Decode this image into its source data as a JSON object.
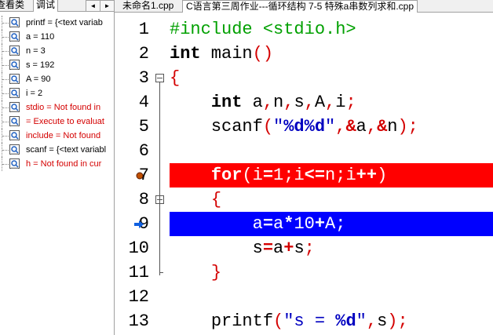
{
  "left_panel": {
    "tabs": [
      "查看类",
      "调试"
    ],
    "arrows": [
      "◄",
      "►"
    ],
    "watches": [
      {
        "text": "printf = {<text variab",
        "error": false
      },
      {
        "text": "a = 110",
        "error": false
      },
      {
        "text": "n = 3",
        "error": false
      },
      {
        "text": "s = 192",
        "error": false
      },
      {
        "text": "A = 90",
        "error": false
      },
      {
        "text": "i = 2",
        "error": false
      },
      {
        "text": "stdio = Not found in",
        "error": true
      },
      {
        "text": " = Execute to evaluat",
        "error": true
      },
      {
        "text": "include = Not found",
        "error": true
      },
      {
        "text": "scanf = {<text variabl",
        "error": false
      },
      {
        "text": "h = Not found in cur",
        "error": true
      }
    ]
  },
  "editor_tabs": [
    "未命名1.cpp",
    "C语言第三周作业---循环结构 7-5 特殊a串数列求和.cpp"
  ],
  "code": {
    "line_numbers": [
      "1",
      "2",
      "3",
      "4",
      "5",
      "6",
      "7",
      "8",
      "9",
      "10",
      "11",
      "12",
      "13"
    ],
    "l1": "#include <stdio.h>",
    "l2_kw": "int",
    "l2_rest": " main",
    "l2_paren": "()",
    "l3": "{",
    "l4": {
      "kw": "int",
      "a": "a",
      "n": "n",
      "s": "s",
      "A": "A",
      "i": "i",
      "comma": ",",
      "semi": ";"
    },
    "l5": {
      "fn": "scanf",
      "open": "(",
      "str1": "\"",
      "fmt": "%d%d",
      "str2": "\"",
      "c1": ",",
      "amp": "&",
      "a": "a",
      "n": "n",
      "close": ")",
      "semi": ";"
    },
    "l7": {
      "kw": "for",
      "open": "(",
      "i": "i",
      "eq": "=",
      "one": "1",
      "semi": ";",
      "le": "<=",
      "n": "n",
      "inc": "++",
      "close": ")"
    },
    "l8": "{",
    "l9": {
      "a": "a",
      "eq": "=",
      "times": "*",
      "ten": "10",
      "plus": "+",
      "A": "A",
      "semi": ";"
    },
    "l10": {
      "s": "s",
      "eq": "=",
      "a": "a",
      "plus": "+",
      "semi": ";"
    },
    "l11": "}",
    "l13": {
      "fn": "printf",
      "open": "(",
      "str": "\"s = ",
      "fmt": "%d",
      "strend": "\"",
      "comma": ",",
      "s": "s",
      "close": ")",
      "semi": ";"
    }
  },
  "colors": {
    "breakpoint_line": "#ff0000",
    "current_line": "#0000ff",
    "preprocessor": "#00a000",
    "symbol": "#d40000",
    "string": "#0000c0",
    "number": "#8000ff"
  }
}
